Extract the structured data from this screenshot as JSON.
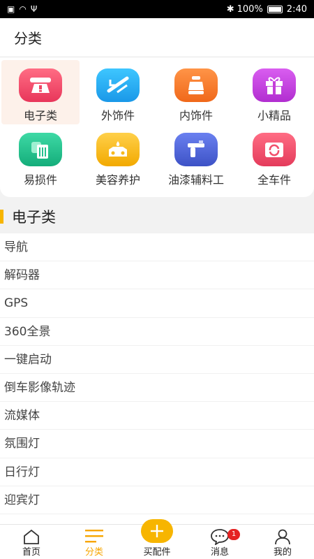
{
  "status_bar": {
    "battery": "100%",
    "time": "2:40"
  },
  "header": {
    "title": "分类"
  },
  "categories": [
    {
      "label": "电子类",
      "icon": "electronics-icon",
      "color": "#f04b6b",
      "selected": true
    },
    {
      "label": "外饰件",
      "icon": "exterior-icon",
      "color": "#22aaf0"
    },
    {
      "label": "内饰件",
      "icon": "car-seat-icon",
      "color": "#fa7d2a"
    },
    {
      "label": "小精品",
      "icon": "gift-icon",
      "color": "#c43fd9"
    },
    {
      "label": "易损件",
      "icon": "trash-bin-icon",
      "color": "#24c18d"
    },
    {
      "label": "美容养护",
      "icon": "car-wash-icon",
      "color": "#f6b91d"
    },
    {
      "label": "油漆辅料工",
      "icon": "spray-gun-icon",
      "color": "#5167d8"
    },
    {
      "label": "全车件",
      "icon": "refresh-box-icon",
      "color": "#f2506b"
    }
  ],
  "section": {
    "title": "电子类",
    "accent": "#f7b500"
  },
  "list_items": [
    "导航",
    "解码器",
    "GPS",
    "360全景",
    "一键启动",
    "倒车影像轨迹",
    "流媒体",
    "氛围灯",
    "日行灯",
    "迎宾灯"
  ],
  "tabs": [
    {
      "label": "首页",
      "icon": "home-icon"
    },
    {
      "label": "分类",
      "icon": "menu-icon",
      "active": true
    },
    {
      "label": "买配件",
      "icon": "plus-icon"
    },
    {
      "label": "消息",
      "icon": "message-icon",
      "badge": "1"
    },
    {
      "label": "我的",
      "icon": "user-icon"
    }
  ]
}
